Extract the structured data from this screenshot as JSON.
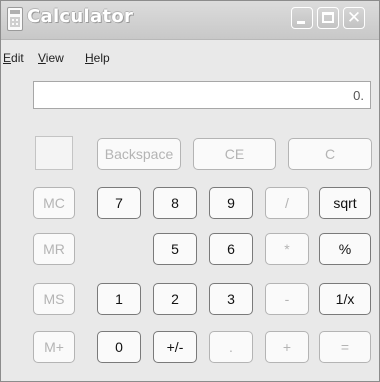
{
  "window": {
    "title": "Calculator"
  },
  "titlebar": {
    "close_glyph": "✕"
  },
  "menu": {
    "edit": "Edit",
    "view": "View",
    "help": "Help"
  },
  "display": {
    "value": "0."
  },
  "buttons": {
    "backspace": "Backspace",
    "ce": "CE",
    "c": "C",
    "mc": "MC",
    "mr": "MR",
    "ms": "MS",
    "mplus": "M+",
    "seven": "7",
    "eight": "8",
    "nine": "9",
    "divide": "/",
    "sqrt": "sqrt",
    "five": "5",
    "six": "6",
    "multiply": "*",
    "percent": "%",
    "one": "1",
    "two": "2",
    "three": "3",
    "minus": "-",
    "reciprocal": "1/x",
    "zero": "0",
    "sign": "+/-",
    "decimal": ".",
    "plus": "+",
    "equals": "="
  }
}
